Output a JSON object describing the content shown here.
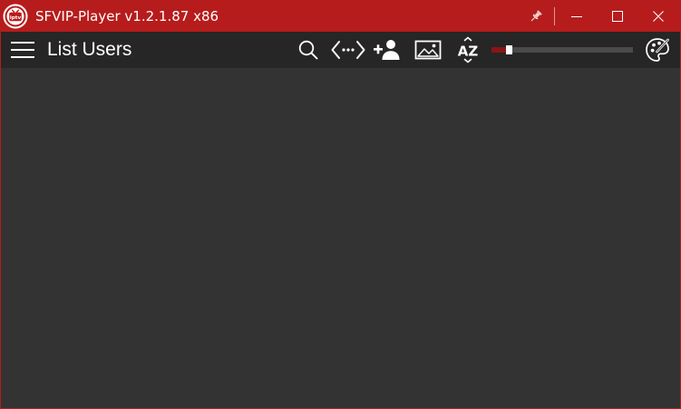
{
  "window": {
    "title": "SFVIP-Player v1.2.1.87 x86",
    "logo_text": "iptv"
  },
  "toolbar": {
    "page_title": "List Users",
    "icons": [
      "menu-icon",
      "search-icon",
      "code-arrows-icon",
      "add-user-icon",
      "image-icon",
      "sort-az-icon",
      "palette-icon"
    ],
    "sort_label": "AZ",
    "slider": {
      "value": 0.11
    }
  },
  "colors": {
    "titlebar": "#b71c1c",
    "toolbar": "#262626",
    "content": "#333333",
    "slider_fill": "#8b1515",
    "slider_track": "#4a4a4a"
  }
}
